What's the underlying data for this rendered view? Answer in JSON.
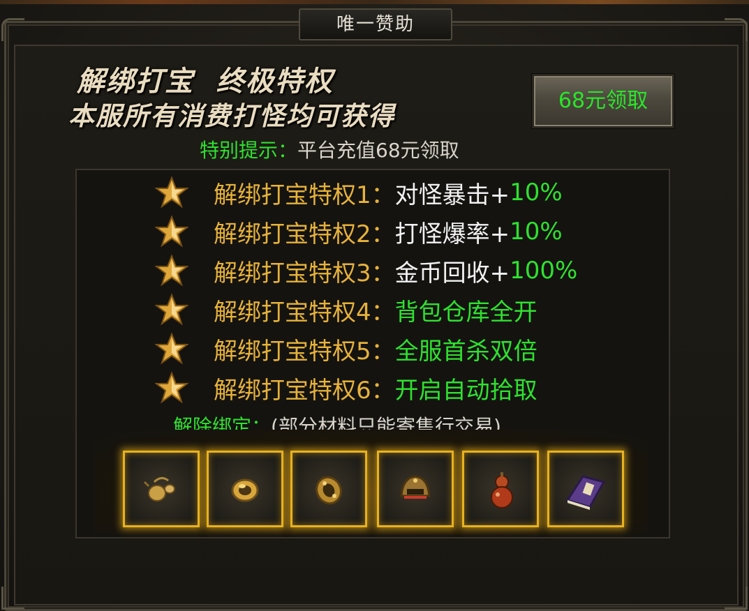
{
  "window": {
    "title": "唯一赞助"
  },
  "banner": {
    "headline": "解绑打宝  终极特权",
    "subline": "本服所有消费打怪均可获得"
  },
  "claim_button": {
    "label": "68元领取"
  },
  "tip": {
    "key": "特别提示：",
    "value": "平台充值68元领取"
  },
  "privileges": [
    {
      "label": "解绑打宝特权1",
      "desc_white": "对怪暴击+",
      "desc_green": "10%"
    },
    {
      "label": "解绑打宝特权2",
      "desc_white": "打怪爆率+",
      "desc_green": "10%"
    },
    {
      "label": "解绑打宝特权3",
      "desc_white": "金币回收+",
      "desc_green": "100%"
    },
    {
      "label": "解绑打宝特权4",
      "desc_white": "",
      "desc_green": "背包仓库全开"
    },
    {
      "label": "解绑打宝特权5",
      "desc_white": "",
      "desc_green": "全服首杀双倍"
    },
    {
      "label": "解绑打宝特权6",
      "desc_white": "",
      "desc_green": "开启自动拾取"
    }
  ],
  "privilege_colon": "：",
  "unbind": {
    "key": "解除绑定：",
    "value": "(部分材料只能寄售行交易)"
  },
  "items": [
    {
      "icon": "gourd-charm-icon"
    },
    {
      "icon": "gold-ring-icon"
    },
    {
      "icon": "gold-bracelet-icon"
    },
    {
      "icon": "helmet-icon"
    },
    {
      "icon": "red-gourd-icon"
    },
    {
      "icon": "skill-book-icon"
    }
  ],
  "colors": {
    "gold": "#e7b23b",
    "green": "#2fe12f",
    "white": "#f2f2f2",
    "slot_border": "#e8b21e"
  }
}
